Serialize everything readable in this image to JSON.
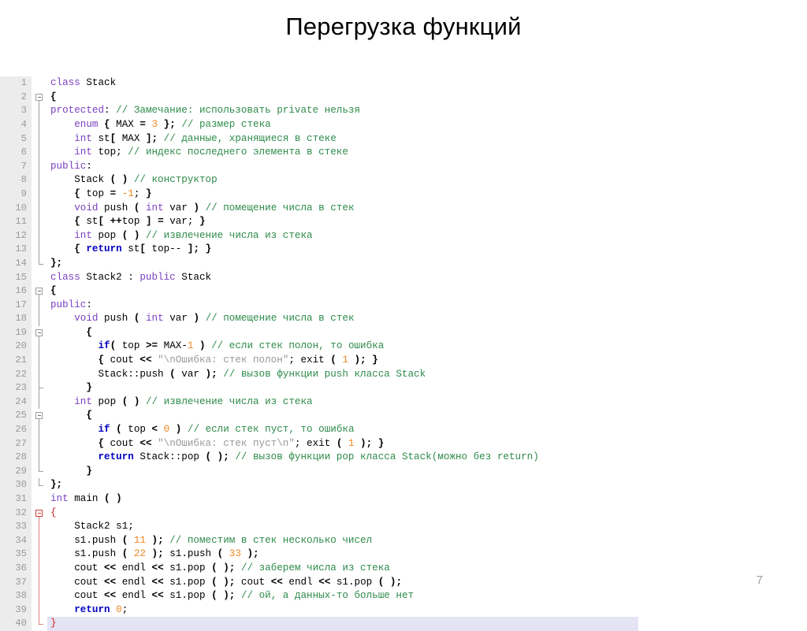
{
  "slide": {
    "title": "Перегрузка функций",
    "page_number": "7"
  },
  "colors": {
    "keyword": "#7a3fbf",
    "control": "#0000c0",
    "comment": "#2e8b4a",
    "number": "#ee8822",
    "string": "#999999",
    "operator": "#000000",
    "error_brace": "#cc2222",
    "gutter_bg": "#ececec",
    "gutter_text": "#9a9a9a",
    "current_line_bg": "#e4e4f5",
    "page_number": "#9c9c9c"
  },
  "editor": {
    "language": "cpp",
    "first_line": 1,
    "last_line": 40,
    "current_line": 40,
    "lines": [
      {
        "n": "1",
        "fold": "none",
        "tokens": [
          {
            "t": "kw",
            "v": "class"
          },
          {
            "t": "plain",
            "v": " Stack"
          }
        ]
      },
      {
        "n": "2",
        "fold": "box",
        "tokens": [
          {
            "t": "op",
            "v": "{"
          }
        ]
      },
      {
        "n": "3",
        "fold": "line",
        "tokens": [
          {
            "t": "kw",
            "v": "protected"
          },
          {
            "t": "plain",
            "v": ": "
          },
          {
            "t": "cmt",
            "v": "// Замечание: использовать private нельзя"
          }
        ]
      },
      {
        "n": "4",
        "fold": "line",
        "tokens": [
          {
            "t": "plain",
            "v": "    "
          },
          {
            "t": "kw",
            "v": "enum"
          },
          {
            "t": "op",
            "v": " { "
          },
          {
            "t": "plain",
            "v": "MAX "
          },
          {
            "t": "op",
            "v": "= "
          },
          {
            "t": "num",
            "v": "3"
          },
          {
            "t": "op",
            "v": " };"
          },
          {
            "t": "plain",
            "v": " "
          },
          {
            "t": "cmt",
            "v": "// размер стека"
          }
        ]
      },
      {
        "n": "5",
        "fold": "line",
        "tokens": [
          {
            "t": "plain",
            "v": "    "
          },
          {
            "t": "kw",
            "v": "int"
          },
          {
            "t": "plain",
            "v": " st"
          },
          {
            "t": "op",
            "v": "[ "
          },
          {
            "t": "plain",
            "v": "MAX"
          },
          {
            "t": "op",
            "v": " ];"
          },
          {
            "t": "plain",
            "v": " "
          },
          {
            "t": "cmt",
            "v": "// данные, хранящиеся в стеке"
          }
        ]
      },
      {
        "n": "6",
        "fold": "line",
        "tokens": [
          {
            "t": "plain",
            "v": "    "
          },
          {
            "t": "kw",
            "v": "int"
          },
          {
            "t": "plain",
            "v": " top; "
          },
          {
            "t": "cmt",
            "v": "// индекс последнего элемента в стеке"
          }
        ]
      },
      {
        "n": "7",
        "fold": "line",
        "tokens": [
          {
            "t": "kw",
            "v": "public"
          },
          {
            "t": "plain",
            "v": ":"
          }
        ]
      },
      {
        "n": "8",
        "fold": "line",
        "tokens": [
          {
            "t": "plain",
            "v": "    Stack "
          },
          {
            "t": "op",
            "v": "( )"
          },
          {
            "t": "plain",
            "v": " "
          },
          {
            "t": "cmt",
            "v": "// конструктор"
          }
        ]
      },
      {
        "n": "9",
        "fold": "line",
        "tokens": [
          {
            "t": "plain",
            "v": "    "
          },
          {
            "t": "op",
            "v": "{ "
          },
          {
            "t": "plain",
            "v": "top "
          },
          {
            "t": "op",
            "v": "= "
          },
          {
            "t": "num",
            "v": "-1"
          },
          {
            "t": "plain",
            "v": "; "
          },
          {
            "t": "op",
            "v": "}"
          }
        ]
      },
      {
        "n": "10",
        "fold": "line",
        "tokens": [
          {
            "t": "plain",
            "v": "    "
          },
          {
            "t": "kw",
            "v": "void"
          },
          {
            "t": "plain",
            "v": " push "
          },
          {
            "t": "op",
            "v": "( "
          },
          {
            "t": "kw",
            "v": "int"
          },
          {
            "t": "plain",
            "v": " var "
          },
          {
            "t": "op",
            "v": ")"
          },
          {
            "t": "plain",
            "v": " "
          },
          {
            "t": "cmt",
            "v": "// помещение числа в стек"
          }
        ]
      },
      {
        "n": "11",
        "fold": "line",
        "tokens": [
          {
            "t": "plain",
            "v": "    "
          },
          {
            "t": "op",
            "v": "{ "
          },
          {
            "t": "plain",
            "v": "st"
          },
          {
            "t": "op",
            "v": "[ ++"
          },
          {
            "t": "plain",
            "v": "top "
          },
          {
            "t": "op",
            "v": "] = "
          },
          {
            "t": "plain",
            "v": "var; "
          },
          {
            "t": "op",
            "v": "}"
          }
        ]
      },
      {
        "n": "12",
        "fold": "line",
        "tokens": [
          {
            "t": "plain",
            "v": "    "
          },
          {
            "t": "kw",
            "v": "int"
          },
          {
            "t": "plain",
            "v": " pop "
          },
          {
            "t": "op",
            "v": "( )"
          },
          {
            "t": "plain",
            "v": " "
          },
          {
            "t": "cmt",
            "v": "// извлечение числа из стека"
          }
        ]
      },
      {
        "n": "13",
        "fold": "line",
        "tokens": [
          {
            "t": "plain",
            "v": "    "
          },
          {
            "t": "op",
            "v": "{ "
          },
          {
            "t": "ctl",
            "v": "return"
          },
          {
            "t": "plain",
            "v": " st"
          },
          {
            "t": "op",
            "v": "[ "
          },
          {
            "t": "plain",
            "v": "top-- "
          },
          {
            "t": "op",
            "v": "]; }"
          }
        ]
      },
      {
        "n": "14",
        "fold": "end",
        "tokens": [
          {
            "t": "op",
            "v": "};"
          }
        ]
      },
      {
        "n": "15",
        "fold": "none",
        "tokens": [
          {
            "t": "kw",
            "v": "class"
          },
          {
            "t": "plain",
            "v": " Stack2 : "
          },
          {
            "t": "kw",
            "v": "public"
          },
          {
            "t": "plain",
            "v": " Stack"
          }
        ]
      },
      {
        "n": "16",
        "fold": "box",
        "tokens": [
          {
            "t": "op",
            "v": "{"
          }
        ]
      },
      {
        "n": "17",
        "fold": "line",
        "tokens": [
          {
            "t": "kw",
            "v": "public"
          },
          {
            "t": "plain",
            "v": ":"
          }
        ]
      },
      {
        "n": "18",
        "fold": "line",
        "tokens": [
          {
            "t": "plain",
            "v": "    "
          },
          {
            "t": "kw",
            "v": "void"
          },
          {
            "t": "plain",
            "v": " push "
          },
          {
            "t": "op",
            "v": "( "
          },
          {
            "t": "kw",
            "v": "int"
          },
          {
            "t": "plain",
            "v": " var "
          },
          {
            "t": "op",
            "v": ")"
          },
          {
            "t": "plain",
            "v": " "
          },
          {
            "t": "cmt",
            "v": "// помещение числа в стек"
          }
        ]
      },
      {
        "n": "19",
        "fold": "box",
        "tokens": [
          {
            "t": "plain",
            "v": "      "
          },
          {
            "t": "op",
            "v": "{"
          }
        ]
      },
      {
        "n": "20",
        "fold": "line",
        "tokens": [
          {
            "t": "plain",
            "v": "        "
          },
          {
            "t": "ctl",
            "v": "if"
          },
          {
            "t": "op",
            "v": "( "
          },
          {
            "t": "plain",
            "v": "top "
          },
          {
            "t": "op",
            "v": ">= "
          },
          {
            "t": "plain",
            "v": "MAX-"
          },
          {
            "t": "num",
            "v": "1"
          },
          {
            "t": "op",
            "v": " )"
          },
          {
            "t": "plain",
            "v": " "
          },
          {
            "t": "cmt",
            "v": "// если стек полон, то ошибка"
          }
        ]
      },
      {
        "n": "21",
        "fold": "line",
        "tokens": [
          {
            "t": "plain",
            "v": "        "
          },
          {
            "t": "op",
            "v": "{ "
          },
          {
            "t": "plain",
            "v": "cout "
          },
          {
            "t": "op",
            "v": "<< "
          },
          {
            "t": "str",
            "v": "\"\\nОшибка: стек полон\""
          },
          {
            "t": "plain",
            "v": "; exit "
          },
          {
            "t": "op",
            "v": "( "
          },
          {
            "t": "num",
            "v": "1"
          },
          {
            "t": "op",
            "v": " ); }"
          }
        ]
      },
      {
        "n": "22",
        "fold": "line",
        "tokens": [
          {
            "t": "plain",
            "v": "        Stack::push "
          },
          {
            "t": "op",
            "v": "( "
          },
          {
            "t": "plain",
            "v": "var "
          },
          {
            "t": "op",
            "v": ");"
          },
          {
            "t": "plain",
            "v": " "
          },
          {
            "t": "cmt",
            "v": "// вызов функции push класса Stack"
          }
        ]
      },
      {
        "n": "23",
        "fold": "tick",
        "tokens": [
          {
            "t": "plain",
            "v": "      "
          },
          {
            "t": "op",
            "v": "}"
          }
        ]
      },
      {
        "n": "24",
        "fold": "line",
        "tokens": [
          {
            "t": "plain",
            "v": "    "
          },
          {
            "t": "kw",
            "v": "int"
          },
          {
            "t": "plain",
            "v": " pop "
          },
          {
            "t": "op",
            "v": "( )"
          },
          {
            "t": "plain",
            "v": " "
          },
          {
            "t": "cmt",
            "v": "// извлечение числа из стека"
          }
        ]
      },
      {
        "n": "25",
        "fold": "box",
        "tokens": [
          {
            "t": "plain",
            "v": "      "
          },
          {
            "t": "op",
            "v": "{"
          }
        ]
      },
      {
        "n": "26",
        "fold": "line",
        "tokens": [
          {
            "t": "plain",
            "v": "        "
          },
          {
            "t": "ctl",
            "v": "if"
          },
          {
            "t": "plain",
            "v": " "
          },
          {
            "t": "op",
            "v": "( "
          },
          {
            "t": "plain",
            "v": "top "
          },
          {
            "t": "op",
            "v": "< "
          },
          {
            "t": "num",
            "v": "0"
          },
          {
            "t": "op",
            "v": " )"
          },
          {
            "t": "plain",
            "v": " "
          },
          {
            "t": "cmt",
            "v": "// если стек пуст, то ошибка"
          }
        ]
      },
      {
        "n": "27",
        "fold": "line",
        "tokens": [
          {
            "t": "plain",
            "v": "        "
          },
          {
            "t": "op",
            "v": "{ "
          },
          {
            "t": "plain",
            "v": "cout "
          },
          {
            "t": "op",
            "v": "<< "
          },
          {
            "t": "str",
            "v": "\"\\nОшибка: стек пуст\\n\""
          },
          {
            "t": "plain",
            "v": "; exit "
          },
          {
            "t": "op",
            "v": "( "
          },
          {
            "t": "num",
            "v": "1"
          },
          {
            "t": "op",
            "v": " ); }"
          }
        ]
      },
      {
        "n": "28",
        "fold": "line",
        "tokens": [
          {
            "t": "plain",
            "v": "        "
          },
          {
            "t": "ctl",
            "v": "return"
          },
          {
            "t": "plain",
            "v": " Stack::pop "
          },
          {
            "t": "op",
            "v": "( );"
          },
          {
            "t": "plain",
            "v": " "
          },
          {
            "t": "cmt",
            "v": "// вызов функции pop класса Stack(можно без return)"
          }
        ]
      },
      {
        "n": "29",
        "fold": "end",
        "tokens": [
          {
            "t": "plain",
            "v": "      "
          },
          {
            "t": "op",
            "v": "}"
          }
        ]
      },
      {
        "n": "30",
        "fold": "end",
        "tokens": [
          {
            "t": "op",
            "v": "};"
          }
        ]
      },
      {
        "n": "31",
        "fold": "none",
        "tokens": [
          {
            "t": "kw",
            "v": "int"
          },
          {
            "t": "plain",
            "v": " main "
          },
          {
            "t": "op",
            "v": "( )"
          }
        ]
      },
      {
        "n": "32",
        "fold": "box-red",
        "tokens": [
          {
            "t": "err",
            "v": "{"
          }
        ]
      },
      {
        "n": "33",
        "fold": "line-red",
        "tokens": [
          {
            "t": "plain",
            "v": "    Stack2 s1;"
          }
        ]
      },
      {
        "n": "34",
        "fold": "line-red",
        "tokens": [
          {
            "t": "plain",
            "v": "    s1.push "
          },
          {
            "t": "op",
            "v": "( "
          },
          {
            "t": "num",
            "v": "11"
          },
          {
            "t": "op",
            "v": " );"
          },
          {
            "t": "plain",
            "v": " "
          },
          {
            "t": "cmt",
            "v": "// поместим в стек несколько чисел"
          }
        ]
      },
      {
        "n": "35",
        "fold": "line-red",
        "tokens": [
          {
            "t": "plain",
            "v": "    s1.push "
          },
          {
            "t": "op",
            "v": "( "
          },
          {
            "t": "num",
            "v": "22"
          },
          {
            "t": "op",
            "v": " );"
          },
          {
            "t": "plain",
            "v": " s1.push "
          },
          {
            "t": "op",
            "v": "( "
          },
          {
            "t": "num",
            "v": "33"
          },
          {
            "t": "op",
            "v": " );"
          }
        ]
      },
      {
        "n": "36",
        "fold": "line-red",
        "tokens": [
          {
            "t": "plain",
            "v": "    cout "
          },
          {
            "t": "op",
            "v": "<< "
          },
          {
            "t": "plain",
            "v": "endl "
          },
          {
            "t": "op",
            "v": "<< "
          },
          {
            "t": "plain",
            "v": "s1.pop "
          },
          {
            "t": "op",
            "v": "( );"
          },
          {
            "t": "plain",
            "v": " "
          },
          {
            "t": "cmt",
            "v": "// заберем числа из стека"
          }
        ]
      },
      {
        "n": "37",
        "fold": "line-red",
        "tokens": [
          {
            "t": "plain",
            "v": "    cout "
          },
          {
            "t": "op",
            "v": "<< "
          },
          {
            "t": "plain",
            "v": "endl "
          },
          {
            "t": "op",
            "v": "<< "
          },
          {
            "t": "plain",
            "v": "s1.pop "
          },
          {
            "t": "op",
            "v": "( );"
          },
          {
            "t": "plain",
            "v": " cout "
          },
          {
            "t": "op",
            "v": "<< "
          },
          {
            "t": "plain",
            "v": "endl "
          },
          {
            "t": "op",
            "v": "<< "
          },
          {
            "t": "plain",
            "v": "s1.pop "
          },
          {
            "t": "op",
            "v": "( );"
          }
        ]
      },
      {
        "n": "38",
        "fold": "line-red",
        "tokens": [
          {
            "t": "plain",
            "v": "    cout "
          },
          {
            "t": "op",
            "v": "<< "
          },
          {
            "t": "plain",
            "v": "endl "
          },
          {
            "t": "op",
            "v": "<< "
          },
          {
            "t": "plain",
            "v": "s1.pop "
          },
          {
            "t": "op",
            "v": "( );"
          },
          {
            "t": "plain",
            "v": " "
          },
          {
            "t": "cmt",
            "v": "// ой, а данных-то больше нет"
          }
        ]
      },
      {
        "n": "39",
        "fold": "line-red",
        "tokens": [
          {
            "t": "plain",
            "v": "    "
          },
          {
            "t": "ctl",
            "v": "return"
          },
          {
            "t": "plain",
            "v": " "
          },
          {
            "t": "num",
            "v": "0"
          },
          {
            "t": "plain",
            "v": ";"
          }
        ]
      },
      {
        "n": "40",
        "fold": "end-red",
        "current": true,
        "tokens": [
          {
            "t": "err",
            "v": "}"
          }
        ]
      }
    ]
  }
}
